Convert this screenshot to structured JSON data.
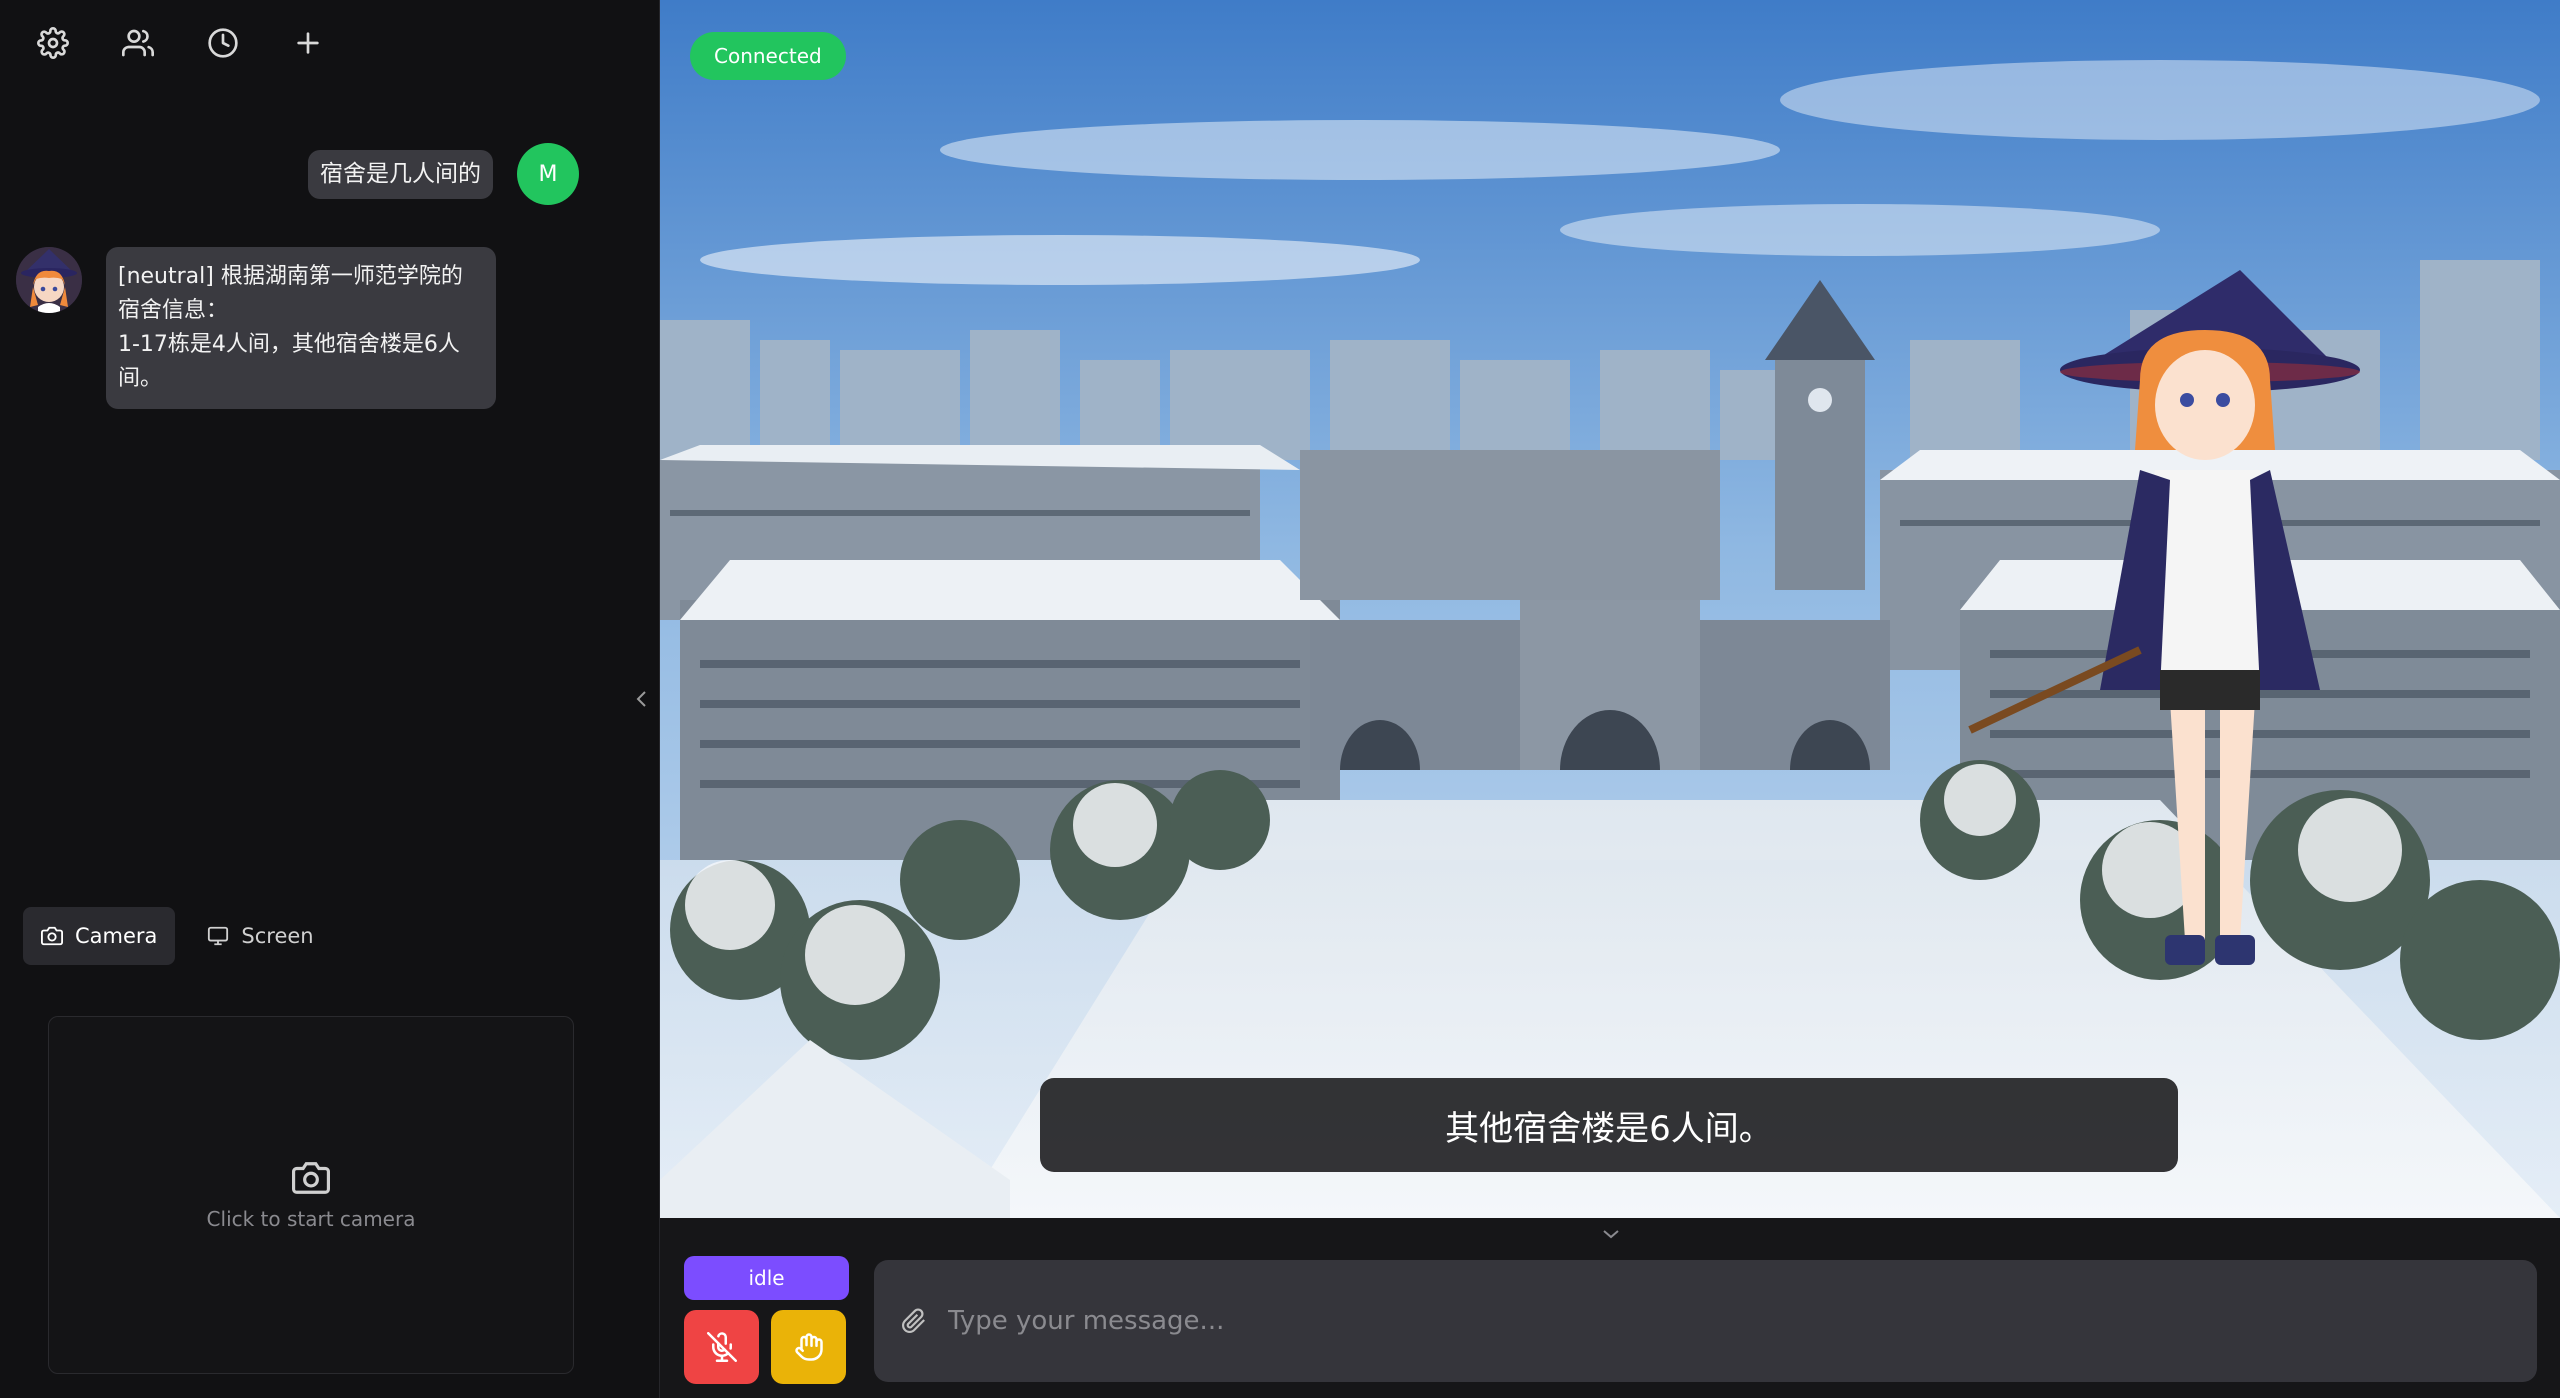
{
  "toolbar": {
    "settings_icon": "gear-icon",
    "characters_icon": "users-icon",
    "history_icon": "clock-icon",
    "new_chat_icon": "plus-icon"
  },
  "chat": {
    "messages": [
      {
        "role": "user",
        "avatar_initial": "M",
        "text": "宿舍是几人间的"
      },
      {
        "role": "assistant",
        "text": "[neutral] 根据湖南第一师范学院的宿舍信息：\n1-17栋是4人间，其他宿舍楼是6人间。"
      }
    ]
  },
  "media_tabs": {
    "camera_label": "Camera",
    "screen_label": "Screen"
  },
  "camera_panel": {
    "hint": "Click to start camera"
  },
  "stage": {
    "connection_status": "Connected",
    "subtitle": "其他宿舍楼是6人间。"
  },
  "controls": {
    "status_label": "idle",
    "input_placeholder": "Type your message..."
  },
  "colors": {
    "connected": "#22c55e",
    "status": "#7c4dff",
    "mic": "#ef4444",
    "interrupt": "#eab308"
  }
}
